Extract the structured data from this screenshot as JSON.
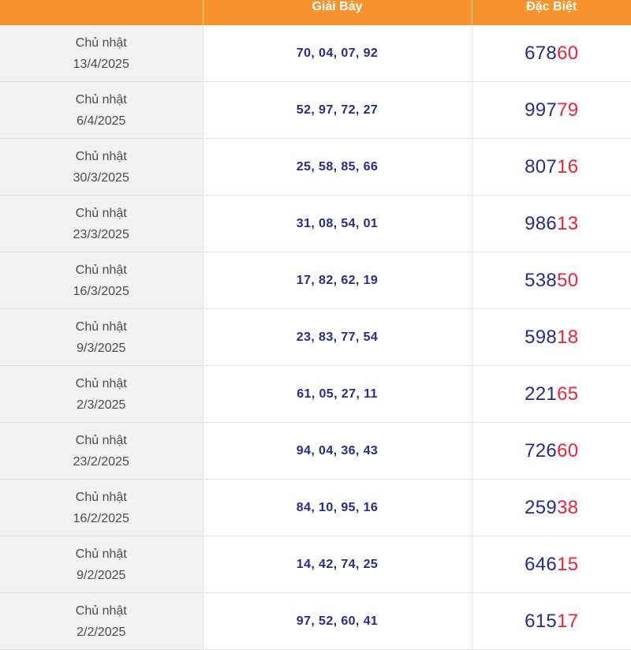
{
  "headers": {
    "col1": "",
    "col2": "Giải Bảy",
    "col3": "Đặc Biệt"
  },
  "colors": {
    "header_bg": "#f7942d",
    "number_blue": "#262b8e",
    "tail_red": "#e8263a",
    "date_bg": "#f1f1f1"
  },
  "rows": [
    {
      "day": "Chủ nhật",
      "date": "13/4/2025",
      "giai_bay": "70, 04, 07, 92",
      "db_head": "678",
      "db_tail": "60"
    },
    {
      "day": "Chủ nhật",
      "date": "6/4/2025",
      "giai_bay": "52, 97, 72, 27",
      "db_head": "997",
      "db_tail": "79"
    },
    {
      "day": "Chủ nhật",
      "date": "30/3/2025",
      "giai_bay": "25, 58, 85, 66",
      "db_head": "807",
      "db_tail": "16"
    },
    {
      "day": "Chủ nhật",
      "date": "23/3/2025",
      "giai_bay": "31, 08, 54, 01",
      "db_head": "986",
      "db_tail": "13"
    },
    {
      "day": "Chủ nhật",
      "date": "16/3/2025",
      "giai_bay": "17, 82, 62, 19",
      "db_head": "538",
      "db_tail": "50"
    },
    {
      "day": "Chủ nhật",
      "date": "9/3/2025",
      "giai_bay": "23, 83, 77, 54",
      "db_head": "598",
      "db_tail": "18"
    },
    {
      "day": "Chủ nhật",
      "date": "2/3/2025",
      "giai_bay": "61, 05, 27, 11",
      "db_head": "221",
      "db_tail": "65"
    },
    {
      "day": "Chủ nhật",
      "date": "23/2/2025",
      "giai_bay": "94, 04, 36, 43",
      "db_head": "726",
      "db_tail": "60"
    },
    {
      "day": "Chủ nhật",
      "date": "16/2/2025",
      "giai_bay": "84, 10, 95, 16",
      "db_head": "259",
      "db_tail": "38"
    },
    {
      "day": "Chủ nhật",
      "date": "9/2/2025",
      "giai_bay": "14, 42, 74, 25",
      "db_head": "646",
      "db_tail": "15"
    },
    {
      "day": "Chủ nhật",
      "date": "2/2/2025",
      "giai_bay": "97, 52, 60, 41",
      "db_head": "615",
      "db_tail": "17"
    }
  ]
}
